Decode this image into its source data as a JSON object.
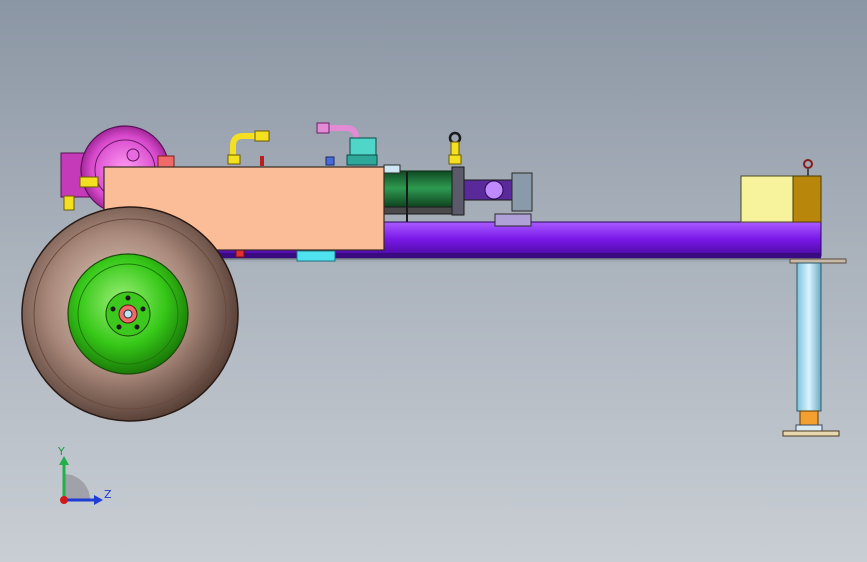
{
  "viewport": {
    "background_top": "#8b96a4",
    "background_bottom": "#c9ced4"
  },
  "colors": {
    "tank": "#fbbd98",
    "beam": "#8a1cf5",
    "cylinder": "#1f7a3a",
    "wheel_rim": "#3edc18",
    "tire": "#8a6a5a",
    "fitting": "#f4e020",
    "motor_housing": "#e055d6",
    "jack": "#b8e6f6",
    "end_block": "#f7f29c",
    "end_block_dark": "#b8860b",
    "cyan_part": "#4fe3f0"
  },
  "triad": {
    "y_label": "Y",
    "z_label": "Z",
    "y_color": "#22b04a",
    "z_color": "#1f3cd6",
    "x_color": "#d01818"
  }
}
